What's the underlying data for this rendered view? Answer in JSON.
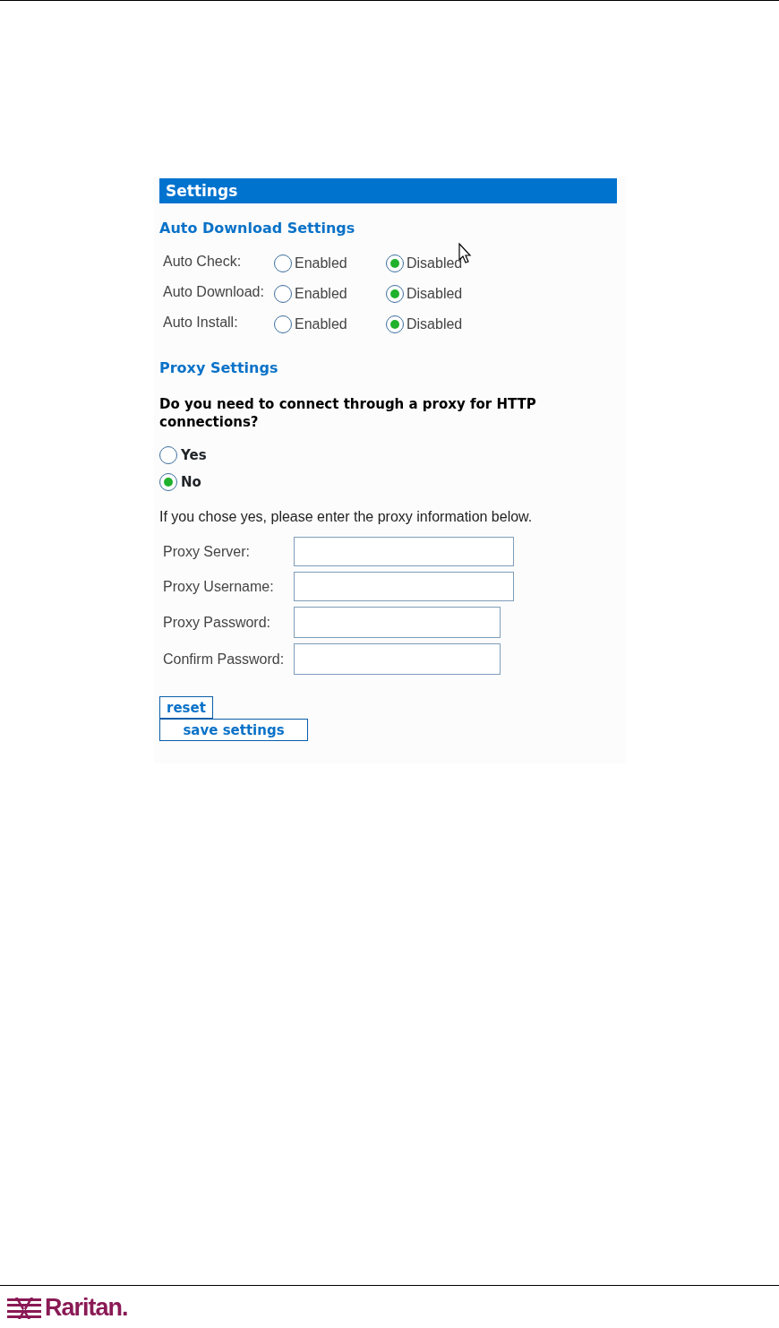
{
  "panel_title": "Settings",
  "auto_download": {
    "heading": "Auto Download Settings",
    "rows": [
      {
        "label": "Auto Check:",
        "options": [
          {
            "label": "Enabled",
            "selected": false
          },
          {
            "label": "Disabled",
            "selected": true
          }
        ]
      },
      {
        "label": "Auto Download:",
        "options": [
          {
            "label": "Enabled",
            "selected": false
          },
          {
            "label": "Disabled",
            "selected": true
          }
        ]
      },
      {
        "label": "Auto Install:",
        "options": [
          {
            "label": "Enabled",
            "selected": false
          },
          {
            "label": "Disabled",
            "selected": true
          }
        ]
      }
    ]
  },
  "proxy": {
    "heading": "Proxy Settings",
    "question": "Do you need to connect through a proxy for HTTP connections?",
    "options": [
      {
        "label": "Yes",
        "selected": false
      },
      {
        "label": "No",
        "selected": true
      }
    ],
    "note": "If you chose yes, please enter the proxy information below.",
    "fields": [
      {
        "label": "Proxy Server:"
      },
      {
        "label": "Proxy Username:"
      },
      {
        "label": "Proxy Password:"
      },
      {
        "label": "Confirm Password:"
      }
    ]
  },
  "buttons": [
    {
      "label": "reset"
    },
    {
      "label": "save settings"
    }
  ],
  "footer": {
    "logo": "Raritan."
  }
}
